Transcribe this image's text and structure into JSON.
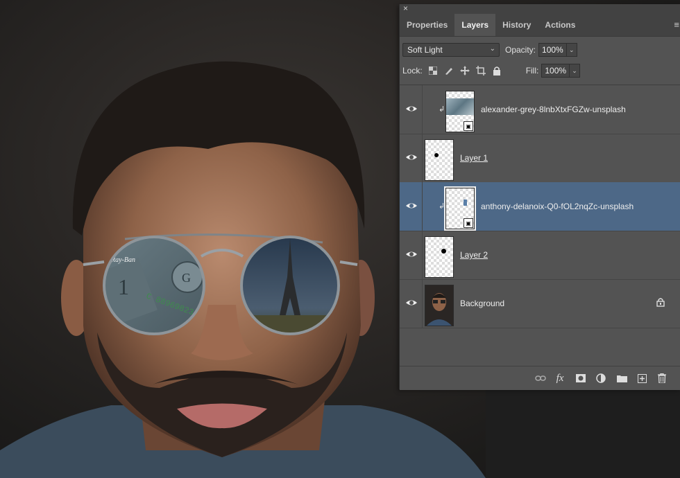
{
  "panel": {
    "close_label": "×",
    "tabs": [
      {
        "label": "Properties",
        "active": false
      },
      {
        "label": "Layers",
        "active": true
      },
      {
        "label": "History",
        "active": false
      },
      {
        "label": "Actions",
        "active": false
      }
    ],
    "menu_icon": "hamburger-menu-icon",
    "blend_mode": "Soft Light",
    "opacity_label": "Opacity:",
    "opacity_value": "100%",
    "lock_label": "Lock:",
    "fill_label": "Fill:",
    "fill_value": "100%",
    "lock_icons": [
      "lock-transparent-pixels-icon",
      "lock-image-pixels-icon",
      "lock-position-icon",
      "lock-artboard-icon",
      "lock-all-icon"
    ],
    "layers": [
      {
        "name": "alexander-grey-8lnbXtxFGZw-unsplash",
        "visible": true,
        "clipped": true,
        "smart_object": true,
        "selected": false,
        "underlined": false
      },
      {
        "name": "Layer 1",
        "visible": true,
        "clipped": false,
        "smart_object": false,
        "selected": false,
        "underlined": true
      },
      {
        "name": "anthony-delanoix-Q0-fOL2nqZc-unsplash",
        "visible": true,
        "clipped": true,
        "smart_object": true,
        "selected": true,
        "underlined": false
      },
      {
        "name": "Layer 2",
        "visible": true,
        "clipped": false,
        "smart_object": false,
        "selected": false,
        "underlined": true
      },
      {
        "name": "Background",
        "visible": true,
        "clipped": false,
        "smart_object": false,
        "selected": false,
        "locked": true,
        "underlined": false
      }
    ],
    "footer_icons": [
      "link-layers-icon",
      "fx-icon",
      "add-mask-icon",
      "adjustment-layer-icon",
      "new-group-icon",
      "new-layer-icon",
      "delete-layer-icon"
    ],
    "fx_label": "fx"
  },
  "canvas": {
    "glasses_brand": "Ray-Ban",
    "bill_serial": "C 88969823",
    "bill_digit": "1",
    "bill_seal_letter": "G"
  },
  "colors": {
    "selected_layer": "#4d6887",
    "panel_bg": "#535353"
  }
}
